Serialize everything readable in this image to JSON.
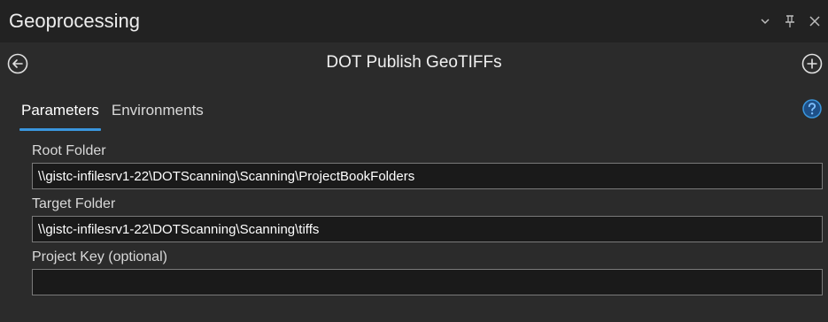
{
  "window": {
    "title": "Geoprocessing"
  },
  "tool": {
    "title": "DOT Publish GeoTIFFs"
  },
  "tabs": [
    {
      "label": "Parameters",
      "active": true
    },
    {
      "label": "Environments",
      "active": false
    }
  ],
  "parameters": [
    {
      "label": "Root Folder",
      "value": "\\\\gistc-infilesrv1-22\\DOTScanning\\Scanning\\ProjectBookFolders"
    },
    {
      "label": "Target Folder",
      "value": "\\\\gistc-infilesrv1-22\\DOTScanning\\Scanning\\tiffs"
    },
    {
      "label": "Project Key (optional)",
      "value": ""
    }
  ],
  "icons": {
    "back": "back-arrow-circle-icon",
    "add": "add-circle-icon",
    "help": "help-circle-icon",
    "options": "chevron-down-icon",
    "pin": "pin-icon",
    "close": "close-icon"
  },
  "colors": {
    "background": "#2b2b2b",
    "titlebar": "#222222",
    "accent": "#3a96dd",
    "input_background": "#1a1a1a",
    "input_border": "#7a7a7a"
  }
}
